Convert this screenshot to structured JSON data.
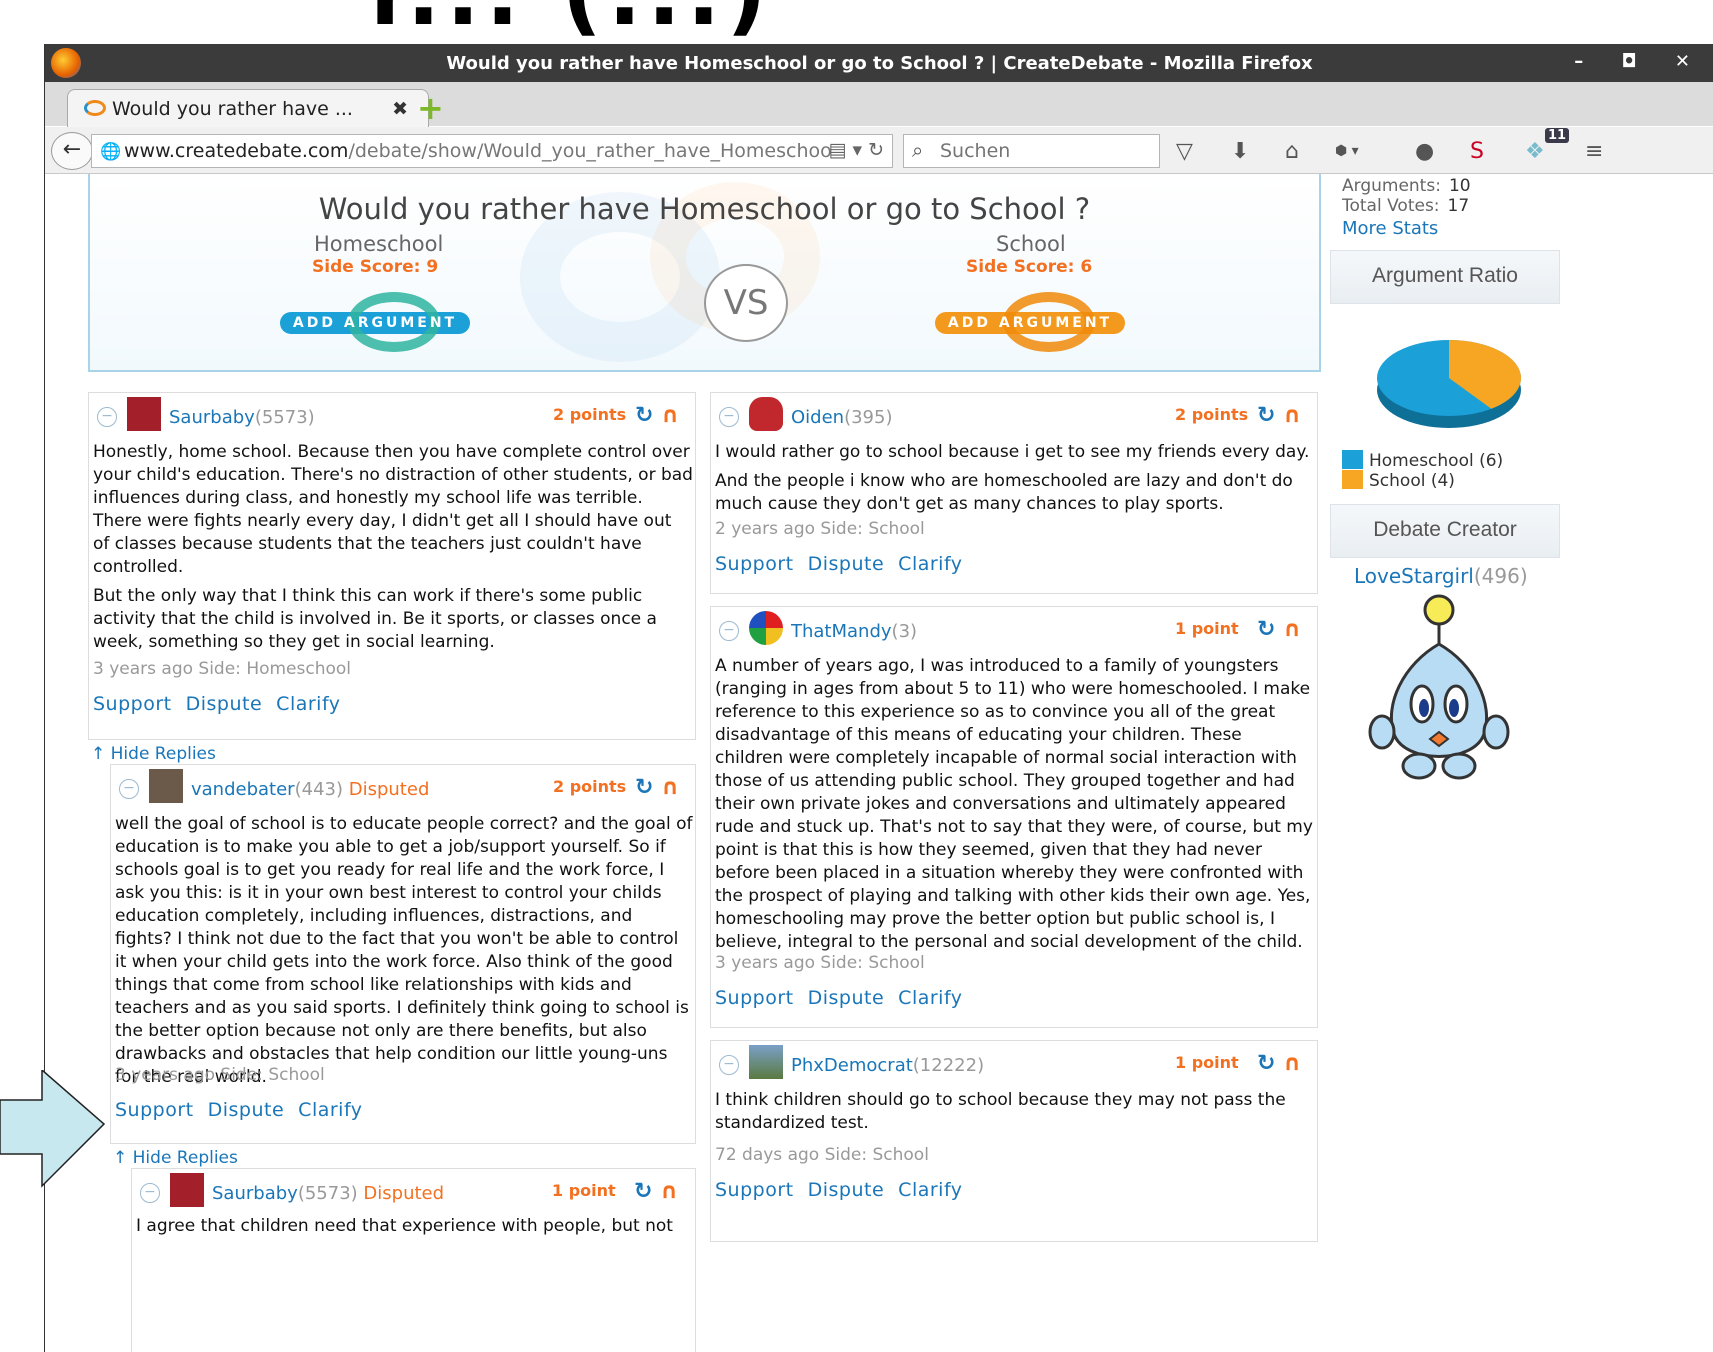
{
  "window": {
    "title": "Would you rather have Homeschool or go to School ? | CreateDebate - Mozilla Firefox",
    "controls": "– ◘ ✕"
  },
  "tab": {
    "label": "Would you rather have ...",
    "close": "✖",
    "new_tab": "+"
  },
  "navbar": {
    "url_domain": "www.createdebate.com",
    "url_path": "/debate/show/Would_you_rather_have_Homeschoo",
    "search_placeholder": "Suchen",
    "badge_count": "11"
  },
  "debate": {
    "title": "Would you rather have Homeschool or go to School ?",
    "vs": "VS",
    "side_left": {
      "name": "Homeschool",
      "score": "Side Score: 9",
      "add_label": "ADD ARGUMENT"
    },
    "side_right": {
      "name": "School",
      "score": "Side Score: 6",
      "add_label": "ADD ARGUMENT"
    }
  },
  "arguments": {
    "a1": {
      "user": "Saurbaby",
      "score": "(5573)",
      "points": "2 points",
      "paras": [
        "Honestly, home school. Because then you have complete control over your child's education. There's no distraction of other students, or bad influences during class, and honestly my school life was terrible. There were fights nearly every day, I didn't get all I should have out of classes because students that the teachers just couldn't have controlled.",
        "But the only way that I think this can work if there's some public activity that the child is involved in. Be it sports, or classes once a week, something so they get in social learning."
      ],
      "meta": "3 years ago Side: Homeschool"
    },
    "a1_reply": {
      "user": "vandebater",
      "score": "(443)",
      "disputed": "Disputed",
      "points": "2 points",
      "paras": [
        "well the goal of school is to educate people correct? and the goal of education is to make you able to get a job/support yourself. So if schools goal is to get you ready for real life and the work force, I ask you this: is it in your own best interest to control your childs education completely, including influences, distractions, and fights? I think not due to the fact that you won't be able to control it when your child gets into the work force. Also think of the good things that come from school like relationships with kids and teachers and as you said sports. I definitely think going to school is the better option because not only are there benefits, but also drawbacks and obstacles that help condition our little young-uns for the real world."
      ],
      "meta": "3 years ago Side: School"
    },
    "a1_reply2": {
      "user": "Saurbaby",
      "score": "(5573)",
      "disputed": "Disputed",
      "points": "1 point",
      "paras": [
        "I agree that children need that experience with people, but not"
      ]
    },
    "b1": {
      "user": "Oiden",
      "score": "(395)",
      "points": "2 points",
      "paras": [
        "I would rather go to school because i get to see my friends every day.",
        "And the people i know who are homeschooled are lazy and don't do much cause they don't get as many chances to play sports."
      ],
      "meta": "2 years ago Side: School"
    },
    "b2": {
      "user": "ThatMandy",
      "score": "(3)",
      "points": "1 point",
      "paras": [
        "A number of years ago, I was introduced to a family of youngsters (ranging in ages from about 5 to 11) who were homeschooled. I make reference to this experience so as to convince you all of the great disadvantage of this means of educating your children. These children were completely incapable of normal social interaction with those of us attending public school. They grouped together and had their own private jokes and conversations and ultimately appeared rude and stuck up. That's not to say that they were, of course, but my point is that this is how they seemed, given that they had never before been placed in a situation whereby they were confronted with the prospect of playing and talking with other kids their own age. Yes, homeschooling may prove the better option but public school is, I believe, integral to the personal and social development of the child."
      ],
      "meta": "3 years ago Side: School"
    },
    "b3": {
      "user": "PhxDemocrat",
      "score": "(12222)",
      "points": "1 point",
      "paras": [
        "I think children should go to school because they may not pass the standardized test."
      ],
      "meta": "72 days ago Side: School"
    }
  },
  "actions": {
    "support": "Support",
    "dispute": "Dispute",
    "clarify": "Clarify",
    "hide_replies": "↑ Hide Replies"
  },
  "sidebar": {
    "arguments_label": "Arguments:",
    "arguments_value": "10",
    "votes_label": "Total Votes:",
    "votes_value": "17",
    "more_stats": "More Stats",
    "ratio_title": "Argument Ratio",
    "legend_homeschool": "Homeschool (6)",
    "legend_school": "School (4)",
    "creator_title": "Debate Creator",
    "creator_name": "LoveStargirl",
    "creator_score": "(496)"
  },
  "ratio_chart": {
    "homeschool": 6,
    "school": 4
  },
  "colors": {
    "homeschool": "#1ca0d8",
    "school": "#f6a623",
    "link": "#1a76b8",
    "accent": "#f37021"
  },
  "top_banner_text": "r... (...)"
}
